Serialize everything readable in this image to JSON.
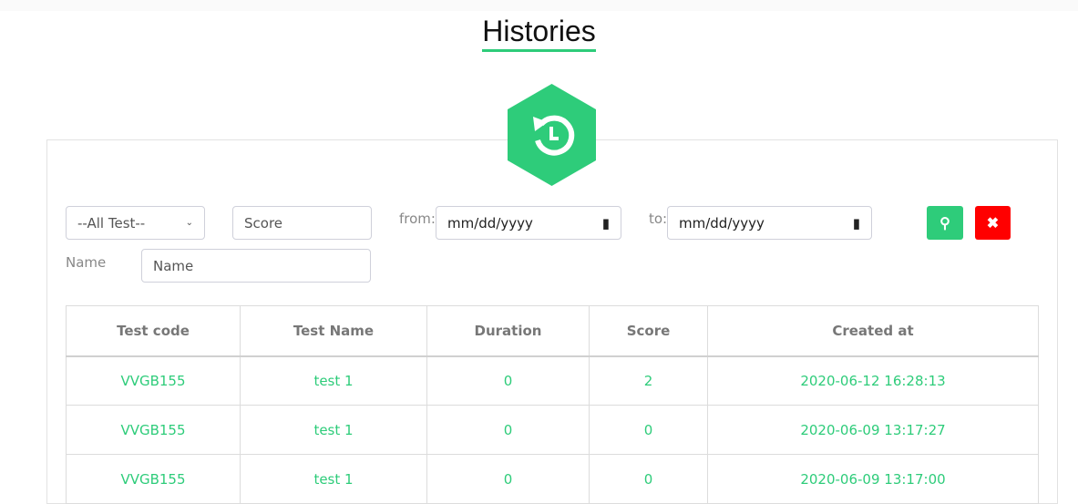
{
  "title": "Histories",
  "filters": {
    "test_select": "--All Test--",
    "score_placeholder": "Score",
    "from_label": "from:",
    "from_placeholder": "mm/dd/yyyy",
    "to_label": "to:",
    "to_placeholder": "mm/dd/yyyy",
    "name_label": "Name",
    "name_placeholder": "Name"
  },
  "colors": {
    "accent": "#2ecc7a",
    "danger": "#ff0000"
  },
  "table": {
    "headers": [
      "Test code",
      "Test Name",
      "Duration",
      "Score",
      "Created at"
    ],
    "rows": [
      [
        "VVGB155",
        "test 1",
        "0",
        "2",
        "2020-06-12 16:28:13"
      ],
      [
        "VVGB155",
        "test 1",
        "0",
        "0",
        "2020-06-09 13:17:27"
      ],
      [
        "VVGB155",
        "test 1",
        "0",
        "0",
        "2020-06-09 13:17:00"
      ]
    ]
  }
}
